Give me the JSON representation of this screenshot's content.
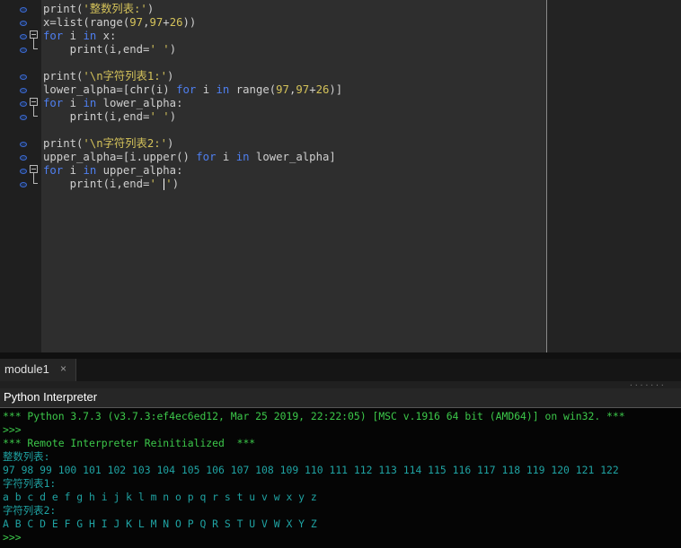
{
  "editor": {
    "lines": [
      [
        {
          "t": "print(",
          "c": "fn"
        },
        {
          "t": "'整数列表:'",
          "c": "st"
        },
        {
          "t": ")",
          "c": "fn"
        }
      ],
      [
        {
          "t": "x=list(range(",
          "c": "fn"
        },
        {
          "t": "97",
          "c": "nm"
        },
        {
          "t": ",",
          "c": "fn"
        },
        {
          "t": "97",
          "c": "nm"
        },
        {
          "t": "+",
          "c": "fn"
        },
        {
          "t": "26",
          "c": "nm"
        },
        {
          "t": "))",
          "c": "fn"
        }
      ],
      [
        {
          "t": "for",
          "c": "kw"
        },
        {
          "t": " i ",
          "c": "fn"
        },
        {
          "t": "in",
          "c": "kw"
        },
        {
          "t": " x:",
          "c": "fn"
        }
      ],
      [
        {
          "t": "    print(i,end=",
          "c": "fn"
        },
        {
          "t": "' '",
          "c": "st"
        },
        {
          "t": ")",
          "c": "fn"
        }
      ],
      [],
      [
        {
          "t": "print(",
          "c": "fn"
        },
        {
          "t": "'\\n字符列表1:'",
          "c": "st"
        },
        {
          "t": ")",
          "c": "fn"
        }
      ],
      [
        {
          "t": "lower_alpha=[chr(i) ",
          "c": "fn"
        },
        {
          "t": "for",
          "c": "kw"
        },
        {
          "t": " i ",
          "c": "fn"
        },
        {
          "t": "in",
          "c": "kw"
        },
        {
          "t": " range(",
          "c": "fn"
        },
        {
          "t": "97",
          "c": "nm"
        },
        {
          "t": ",",
          "c": "fn"
        },
        {
          "t": "97",
          "c": "nm"
        },
        {
          "t": "+",
          "c": "fn"
        },
        {
          "t": "26",
          "c": "nm"
        },
        {
          "t": ")]",
          "c": "fn"
        }
      ],
      [
        {
          "t": "for",
          "c": "kw"
        },
        {
          "t": " i ",
          "c": "fn"
        },
        {
          "t": "in",
          "c": "kw"
        },
        {
          "t": " lower_alpha:",
          "c": "fn"
        }
      ],
      [
        {
          "t": "    print(i,end=",
          "c": "fn"
        },
        {
          "t": "' '",
          "c": "st"
        },
        {
          "t": ")",
          "c": "fn"
        }
      ],
      [],
      [
        {
          "t": "print(",
          "c": "fn"
        },
        {
          "t": "'\\n字符列表2:'",
          "c": "st"
        },
        {
          "t": ")",
          "c": "fn"
        }
      ],
      [
        {
          "t": "upper_alpha=[i.upper() ",
          "c": "fn"
        },
        {
          "t": "for",
          "c": "kw"
        },
        {
          "t": " i ",
          "c": "fn"
        },
        {
          "t": "in",
          "c": "kw"
        },
        {
          "t": " lower_alpha]",
          "c": "fn"
        }
      ],
      [
        {
          "t": "for",
          "c": "kw"
        },
        {
          "t": " i ",
          "c": "fn"
        },
        {
          "t": "in",
          "c": "kw"
        },
        {
          "t": " upper_alpha:",
          "c": "fn"
        }
      ],
      [
        {
          "t": "    print(i,end=",
          "c": "fn"
        },
        {
          "t": "' ",
          "c": "st"
        },
        {
          "t": "",
          "c": "cursor"
        },
        {
          "t": "'",
          "c": "st"
        },
        {
          "t": ")",
          "c": "fn"
        }
      ]
    ]
  },
  "tabs": [
    {
      "label": "module1",
      "close": "×"
    }
  ],
  "panel": {
    "title": "Python Interpreter"
  },
  "console": {
    "lines": [
      {
        "text": "*** Python 3.7.3 (v3.7.3:ef4ec6ed12, Mar 25 2019, 22:22:05) [MSC v.1916 64 bit (AMD64)] on win32. ***",
        "color": "green"
      },
      {
        "text": ">>>",
        "color": "green"
      },
      {
        "text": "*** Remote Interpreter Reinitialized  ***",
        "color": "green"
      },
      {
        "text": "整数列表:",
        "color": "teal"
      },
      {
        "text": "97 98 99 100 101 102 103 104 105 106 107 108 109 110 111 112 113 114 115 116 117 118 119 120 121 122",
        "color": "teal"
      },
      {
        "text": "字符列表1:",
        "color": "teal"
      },
      {
        "text": "a b c d e f g h i j k l m n o p q r s t u v w x y z",
        "color": "teal"
      },
      {
        "text": "字符列表2:",
        "color": "teal"
      },
      {
        "text": "A B C D E F G H I J K L M N O P Q R S T U V W X Y Z",
        "color": "teal"
      },
      {
        "text": ">>>",
        "color": "green"
      }
    ]
  }
}
